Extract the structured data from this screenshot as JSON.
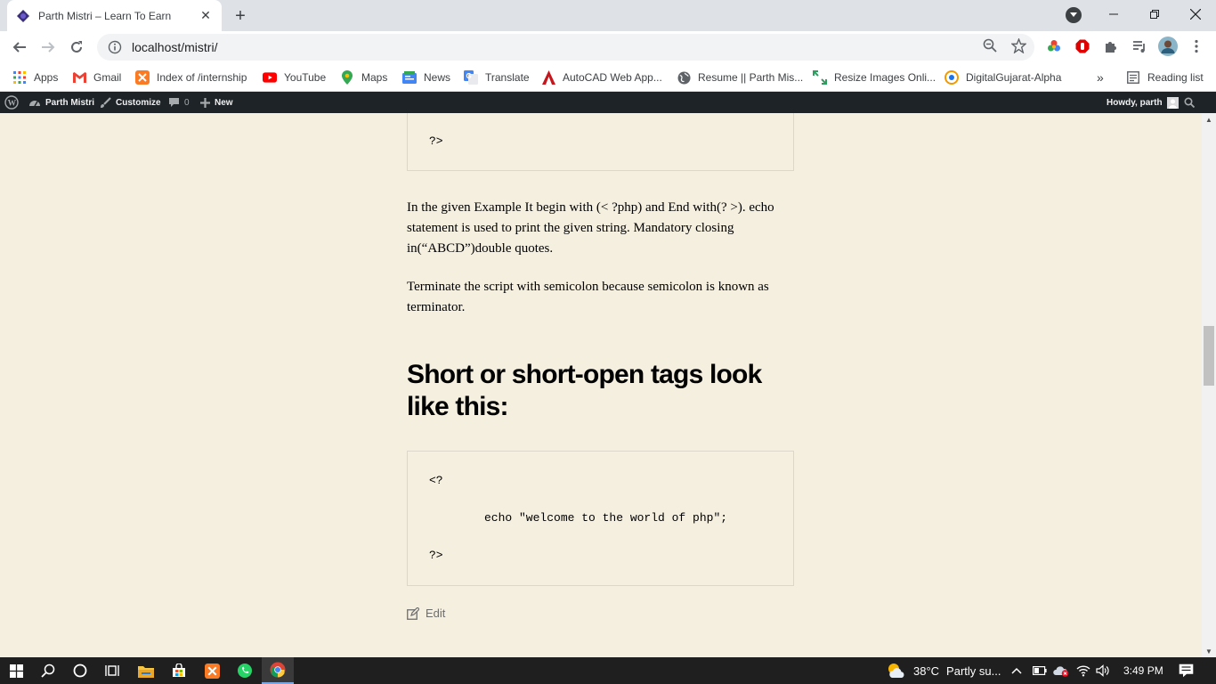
{
  "browser": {
    "tab_title": "Parth Mistri – Learn To Earn",
    "url": "localhost/mistri/"
  },
  "bookmarks": [
    {
      "label": "Apps",
      "icon": "apps-grid-icon",
      "color": "#4285f4"
    },
    {
      "label": "Gmail",
      "icon": "gmail-icon",
      "color": "#ea4335"
    },
    {
      "label": "Index of /internship",
      "icon": "xampp-icon",
      "color": "#fb7a24"
    },
    {
      "label": "YouTube",
      "icon": "youtube-icon",
      "color": "#ff0000"
    },
    {
      "label": "Maps",
      "icon": "maps-pin-icon",
      "color": "#34a853"
    },
    {
      "label": "News",
      "icon": "news-icon",
      "color": "#4285f4"
    },
    {
      "label": "Translate",
      "icon": "translate-icon",
      "color": "#4285f4"
    },
    {
      "label": "AutoCAD Web App...",
      "icon": "autocad-icon",
      "color": "#e51050"
    },
    {
      "label": "Resume || Parth Mis...",
      "icon": "globe-icon",
      "color": "#5f6368"
    },
    {
      "label": "Resize Images Onli...",
      "icon": "resize-icon",
      "color": "#2e9e5e"
    },
    {
      "label": "DigitalGujarat-Alpha",
      "icon": "digitalgujarat-icon",
      "color": "#f29900"
    }
  ],
  "bookmarks_more": "»",
  "reading_list": "Reading list",
  "wp_admin": {
    "site_name": "Parth Mistri",
    "customize": "Customize",
    "comments_count": "0",
    "new": "New",
    "howdy": "Howdy, parth"
  },
  "article": {
    "code_top_close": "?>",
    "para1": "In the given Example It begin with (< ?php) and End with(? >). echo statement is used to print the given string. Mandatory closing in(“ABCD”)double quotes.",
    "para2": "Terminate the script with semicolon because semicolon is known as terminator.",
    "heading": "Short or short-open tags look like this:",
    "code_open": "<?",
    "code_echo": "echo \"welcome to the world of php\";",
    "code_close": "?>",
    "edit": "Edit"
  },
  "taskbar": {
    "weather_temp": "38°C",
    "weather_desc": "Partly su...",
    "time": "3:49 PM"
  },
  "colors": {
    "page_bg": "#f5efe0",
    "wp_bar": "#1d2327",
    "taskbar": "#1f1f1f"
  }
}
